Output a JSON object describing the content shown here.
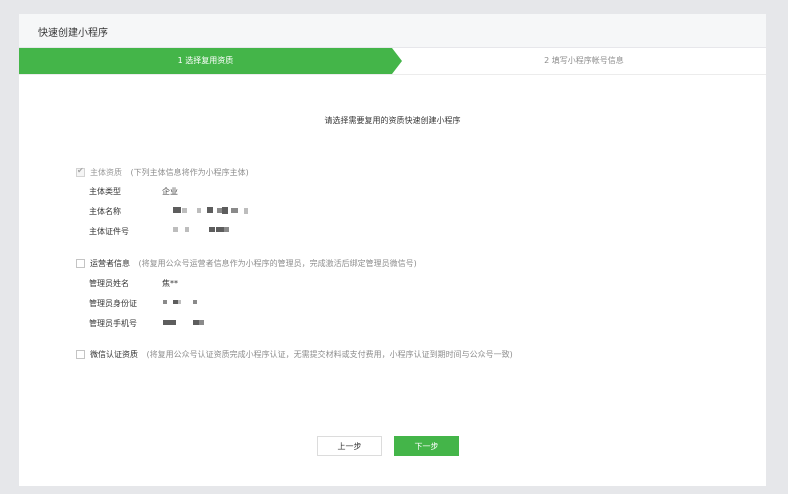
{
  "page": {
    "title": "快速创建小程序"
  },
  "steps": [
    {
      "label": "1 选择复用资质"
    },
    {
      "label": "2 填写小程序帐号信息"
    }
  ],
  "instruction": "请选择需要复用的资质快速创建小程序",
  "sections": {
    "entity": {
      "title": "主体资质",
      "hint": "(下列主体信息将作为小程序主体)",
      "checked": true,
      "rows": [
        {
          "label": "主体类型",
          "value": "企业"
        },
        {
          "label": "主体名称",
          "value": ""
        },
        {
          "label": "主体证件号",
          "value": ""
        }
      ]
    },
    "operator": {
      "title": "运营者信息",
      "hint": "(将复用公众号运营者信息作为小程序的管理员，完成激活后绑定管理员微信号)",
      "checked": false,
      "rows": [
        {
          "label": "管理员姓名",
          "value": "焦**"
        },
        {
          "label": "管理员身份证",
          "value": ""
        },
        {
          "label": "管理员手机号",
          "value": ""
        }
      ]
    },
    "wechat_cert": {
      "title": "微信认证资质",
      "hint": "(将复用公众号认证资质完成小程序认证，无需提交材料或支付费用，小程序认证到期时间与公众号一致)",
      "checked": false
    }
  },
  "buttons": {
    "prev": "上一步",
    "next": "下一步"
  },
  "colors": {
    "accent": "#44b549"
  }
}
